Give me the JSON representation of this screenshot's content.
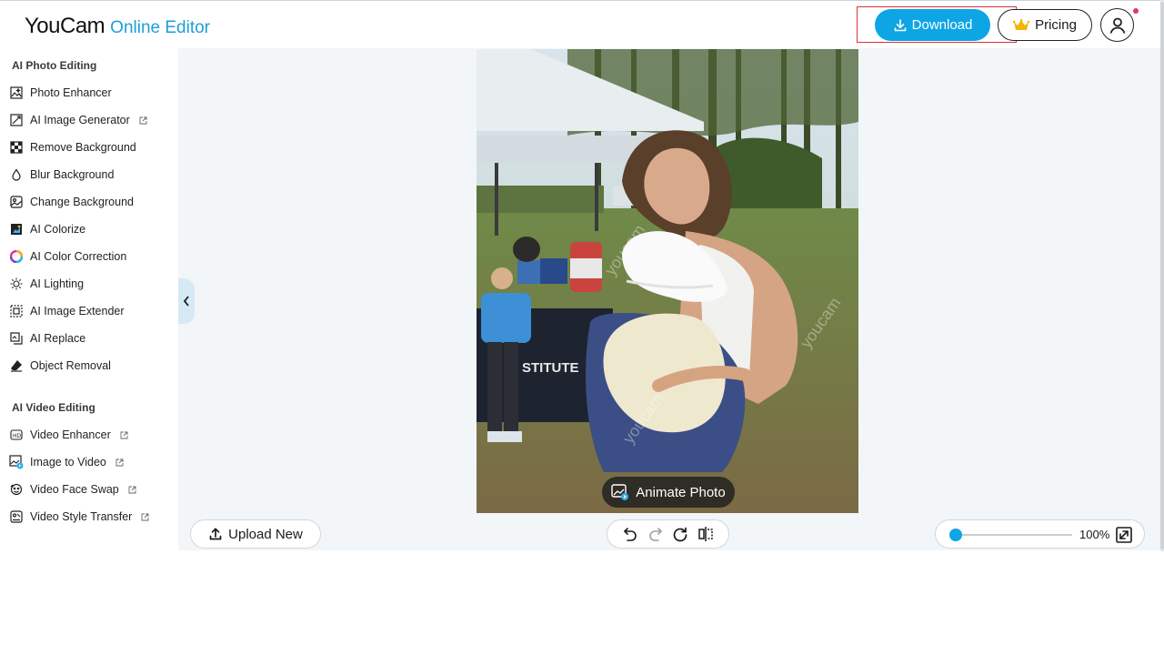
{
  "header": {
    "logo_main": "YouCam",
    "logo_sub": "Online Editor",
    "download_label": "Download",
    "pricing_label": "Pricing"
  },
  "sidebar": {
    "photo_section_title": "AI Photo Editing",
    "photo_items": [
      {
        "label": "Photo Enhancer",
        "icon": "photo-enhancer-icon",
        "external": false
      },
      {
        "label": "AI Image Generator",
        "icon": "ai-image-generator-icon",
        "external": true
      },
      {
        "label": "Remove Background",
        "icon": "remove-background-icon",
        "external": false
      },
      {
        "label": "Blur Background",
        "icon": "blur-background-icon",
        "external": false
      },
      {
        "label": "Change Background",
        "icon": "change-background-icon",
        "external": false
      },
      {
        "label": "AI Colorize",
        "icon": "colorize-icon",
        "external": false
      },
      {
        "label": "AI Color Correction",
        "icon": "color-correction-icon",
        "external": false
      },
      {
        "label": "AI Lighting",
        "icon": "lighting-icon",
        "external": false
      },
      {
        "label": "AI Image Extender",
        "icon": "image-extender-icon",
        "external": false
      },
      {
        "label": "AI Replace",
        "icon": "replace-icon",
        "external": false
      },
      {
        "label": "Object Removal",
        "icon": "object-removal-icon",
        "external": false
      }
    ],
    "video_section_title": "AI Video Editing",
    "video_items": [
      {
        "label": "Video Enhancer",
        "icon": "video-enhancer-icon",
        "external": true
      },
      {
        "label": "Image to Video",
        "icon": "image-to-video-icon",
        "external": true
      },
      {
        "label": "Video Face Swap",
        "icon": "face-swap-icon",
        "external": true
      },
      {
        "label": "Video Style Transfer",
        "icon": "style-transfer-icon",
        "external": true
      }
    ]
  },
  "canvas": {
    "photo_watermark": "youcam",
    "photo_sign_text": "STITUTE",
    "animate_label": "Animate Photo",
    "upload_label": "Upload New",
    "zoom_value": "100%",
    "zoom_level": 0.0
  },
  "colors": {
    "accent": "#0ea5e5",
    "highlight": "#d9333a",
    "canvas_bg": "#f2f6f8",
    "notify": "#e5336b"
  }
}
